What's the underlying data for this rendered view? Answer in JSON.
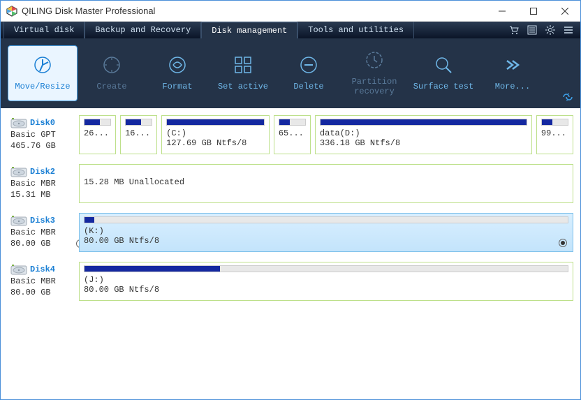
{
  "app": {
    "title": "QILING Disk Master Professional"
  },
  "tabs": {
    "virtual": "Virtual disk",
    "backup": "Backup and Recovery",
    "diskmgmt": "Disk management",
    "tools": "Tools and utilities",
    "active": "diskmgmt"
  },
  "toolbar": {
    "moveresize": "Move/Resize",
    "create": "Create",
    "format": "Format",
    "setactive": "Set active",
    "delete": "Delete",
    "partrecovery": "Partition\nrecovery",
    "surfacetest": "Surface test",
    "more": "More..."
  },
  "disks": [
    {
      "name": "Disk0",
      "type": "Basic GPT",
      "size": "465.76 GB",
      "parts": [
        {
          "label1": "",
          "label2": "26...",
          "fillPct": 60,
          "widthFlex": 5
        },
        {
          "label1": "",
          "label2": "16...",
          "fillPct": 60,
          "widthFlex": 5
        },
        {
          "label1": "(C:)",
          "label2": "127.69 GB Ntfs/8",
          "fillPct": 100,
          "widthFlex": 18
        },
        {
          "label1": "",
          "label2": "65...",
          "fillPct": 40,
          "widthFlex": 5
        },
        {
          "label1": "data(D:)",
          "label2": "336.18 GB Ntfs/8",
          "fillPct": 100,
          "widthFlex": 38
        },
        {
          "label1": "",
          "label2": "99...",
          "fillPct": 40,
          "widthFlex": 5
        }
      ]
    },
    {
      "name": "Disk2",
      "type": "Basic MBR",
      "size": "15.31 MB",
      "parts": [
        {
          "label1": "",
          "label2": "15.28 MB Unallocated",
          "fillPct": 0,
          "widthFlex": 100,
          "nobar": true
        }
      ]
    },
    {
      "name": "Disk3",
      "type": "Basic MBR",
      "size": "80.00 GB",
      "selected": true,
      "parts": [
        {
          "label1": "(K:)",
          "label2": "80.00 GB Ntfs/8",
          "fillPct": 2,
          "widthFlex": 100,
          "selected": true
        }
      ]
    },
    {
      "name": "Disk4",
      "type": "Basic MBR",
      "size": "80.00 GB",
      "parts": [
        {
          "label1": "(J:)",
          "label2": "80.00 GB Ntfs/8",
          "fillPct": 28,
          "widthFlex": 100
        }
      ]
    }
  ]
}
